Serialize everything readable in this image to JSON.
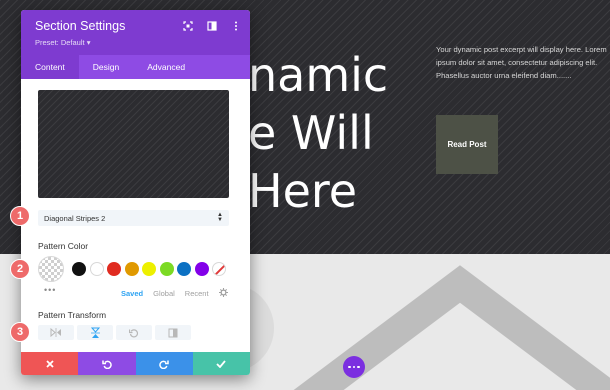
{
  "hero": {
    "title": "namic\ne Will\nHere",
    "excerpt": "Your dynamic post excerpt will display here. Lorem ipsum dolor sit amet, consectetur adipiscing elit. Phasellus auctor urna eleifend diam.......",
    "button_label": "Read Post"
  },
  "panel": {
    "title": "Section Settings",
    "preset": "Preset: Default ▾",
    "tabs": [
      {
        "label": "Content"
      },
      {
        "label": "Design"
      },
      {
        "label": "Advanced"
      }
    ],
    "pattern_select_value": "Diagonal Stripes 2",
    "pattern_color_label": "Pattern Color",
    "swatch_tabs": {
      "saved": "Saved",
      "global": "Global",
      "recent": "Recent"
    },
    "pattern_transform_label": "Pattern Transform",
    "swatch_colors": [
      "#111111",
      "#ffffff",
      "#e02b20",
      "#e09900",
      "#edf000",
      "#7cda24",
      "#0c71c3",
      "#8300e9"
    ]
  },
  "callouts": [
    "1",
    "2",
    "3"
  ],
  "colors": {
    "panel_header": "#7e3bd0",
    "tab_bar": "#8e4be4",
    "accent_blue": "#2ea3f2",
    "cancel": "#ef5555",
    "undo": "#8e4be4",
    "redo": "#3b91e9",
    "save": "#47c3a8",
    "callout": "#ee6a6a"
  },
  "icons": {
    "header": [
      "fullscreen-icon",
      "split-view-icon",
      "more-vertical-icon"
    ],
    "transform": [
      "flip-horizontal-icon",
      "flip-vertical-icon",
      "rotate-icon",
      "invert-icon"
    ],
    "footer": [
      "close-icon",
      "undo-icon",
      "redo-icon",
      "check-icon"
    ]
  }
}
